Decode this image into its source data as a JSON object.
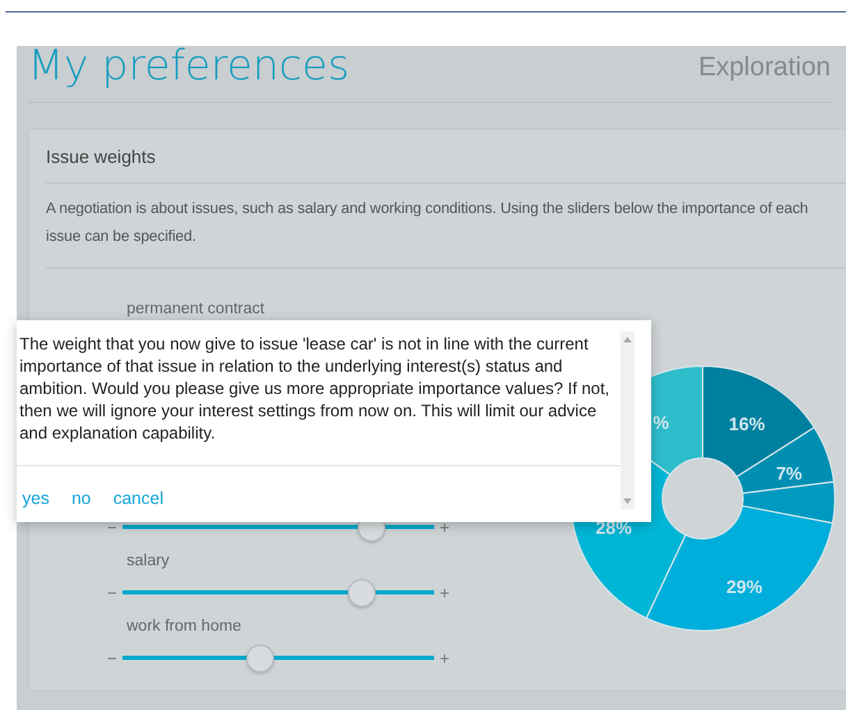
{
  "page": {
    "title": "My preferences",
    "phase": "Exploration"
  },
  "card": {
    "title": "Issue weights",
    "description": "A negotiation is about issues, such as salary and working conditions. Using the sliders below the importance of each issue can be specified.",
    "issues": [
      {
        "label": "permanent contract"
      },
      {
        "level": 0.8,
        "min_label": "−",
        "max_label": "+"
      },
      {
        "label": "salary",
        "level": 0.77,
        "min_label": "−",
        "max_label": "+"
      },
      {
        "label": "work from home",
        "level": 0.44,
        "min_label": "−",
        "max_label": "+"
      }
    ],
    "chart_data": {
      "type": "donut",
      "series": [
        {
          "values": [
            16,
            7,
            5,
            29,
            28,
            15
          ]
        }
      ],
      "colors": [
        "#00809f",
        "#008fb3",
        "#0099c0",
        "#00aedb",
        "#00b6d6",
        "#2ebdcb"
      ],
      "value_labels": [
        "16%",
        "7%",
        null,
        "29%",
        "28%",
        "%"
      ]
    }
  },
  "dialog": {
    "message": "The weight that you now give to issue 'lease car' is not in line with the current importance of that issue in relation to the underlying interest(s) status and ambition. Would you please give us more appropriate importance values? If not, then we will ignore your interest settings from now on. This will limit our advice and explanation capability.",
    "buttons": [
      "yes",
      "no",
      "cancel"
    ]
  }
}
